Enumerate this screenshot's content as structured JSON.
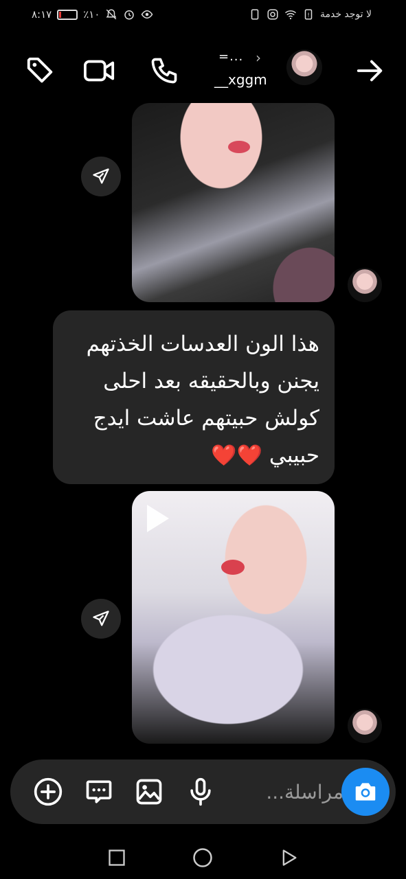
{
  "status_bar": {
    "time": "٨:١٧",
    "battery_percent": "٪١٠",
    "battery_level": 0.1,
    "carrier": "لا توجد خدمة"
  },
  "header": {
    "title": "=...",
    "username": "__xggm",
    "icons": [
      "tag-icon",
      "video-call-icon",
      "phone-icon",
      "chevron-right-icon",
      "arrow-right-icon"
    ]
  },
  "messages": {
    "text": "هذا الون العدسات الخذتهم يجنن وبالحقيقه بعد احلى كولش حبيتهم عاشت ايدج حبيبي",
    "hearts": "❤️❤️"
  },
  "composer": {
    "placeholder": "مراسلة...",
    "icons": [
      "add-icon",
      "sticker-icon",
      "gallery-icon",
      "microphone-icon",
      "camera-icon"
    ]
  },
  "colors": {
    "background": "#000000",
    "bubble": "#262626",
    "accent": "#1b8cf2",
    "heart": "#e0242f"
  }
}
